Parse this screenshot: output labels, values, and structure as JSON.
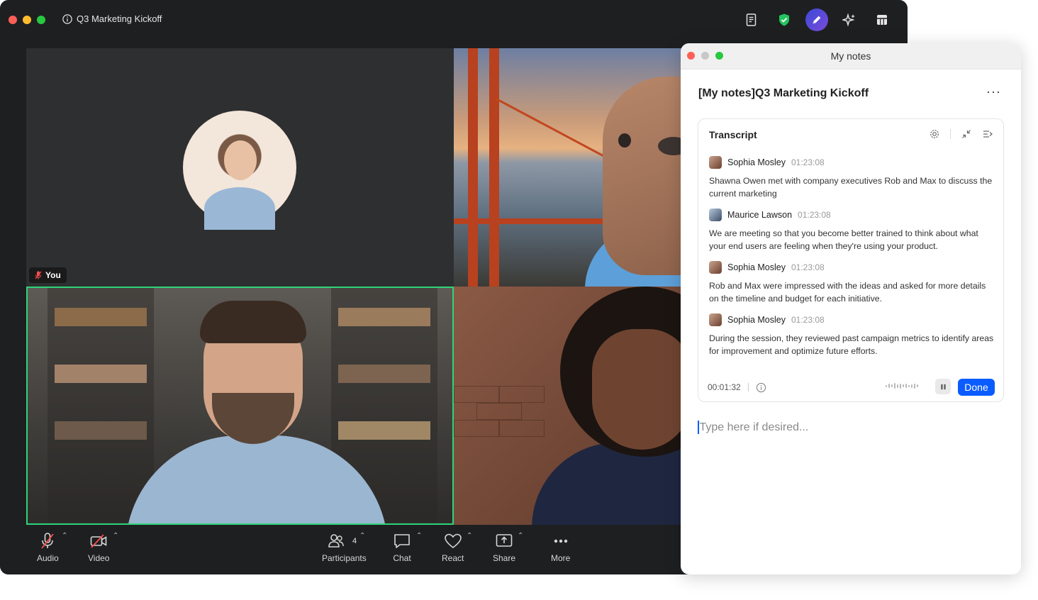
{
  "meeting": {
    "title": "Q3 Marketing Kickoff",
    "self_label": "You",
    "toolbar": {
      "audio": "Audio",
      "video": "Video",
      "participants": "Participants",
      "participants_count": "4",
      "chat": "Chat",
      "react": "React",
      "share": "Share",
      "more": "More"
    },
    "colors": {
      "active_speaker_border": "#2ed47a",
      "window_bg": "#1e1f20"
    }
  },
  "notes": {
    "window_title": "My notes",
    "doc_title": "[My notes]Q3 Marketing Kickoff",
    "transcript": {
      "heading": "Transcript",
      "entries": [
        {
          "name": "Sophia Mosley",
          "time": "01:23:08",
          "text": "Shawna Owen met with company executives Rob and Max to discuss the current marketing"
        },
        {
          "name": "Maurice Lawson",
          "time": "01:23:08",
          "text": "We are meeting so that you become better trained to think about what your end users are feeling when they're using your product."
        },
        {
          "name": "Sophia Mosley",
          "time": "01:23:08",
          "text": "Rob and Max were impressed with the ideas and asked for more details on the timeline and budget for each initiative."
        },
        {
          "name": "Sophia Mosley",
          "time": "01:23:08",
          "text": "During the session, they reviewed past campaign metrics to identify areas for improvement and optimize future efforts."
        }
      ],
      "elapsed": "00:01:32",
      "done_label": "Done"
    },
    "input_placeholder": "Type here if desired...",
    "colors": {
      "accent": "#0b5cff"
    }
  }
}
